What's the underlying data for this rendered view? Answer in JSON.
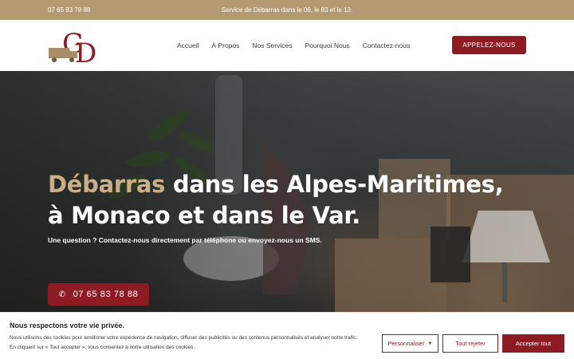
{
  "topbar": {
    "phone": "07 65 83 78 88",
    "service": "Service de Débarras dans le 06, le 83 et le 13."
  },
  "header": {
    "logo_text": "GD",
    "nav": [
      "Accueil",
      "À Propos",
      "Nos Services",
      "Pourquoi Nous",
      "Contactez-nous"
    ],
    "cta": "APPELEZ-NOUS"
  },
  "hero": {
    "title_accent": "Débarras",
    "title_rest_line1": " dans les Alpes-Maritimes,",
    "title_line2": "à Monaco et dans le Var.",
    "subtitle": "Une question ? Contactez-nous directement par téléphone ou envoyez-nous un SMS.",
    "cta_phone": "07 65 83 78 88",
    "cta_icon": "phone-icon"
  },
  "cookie": {
    "title": "Nous respectons votre vie privée.",
    "text1": "Nous utilisons des cookies pour améliorer votre expérience de navigation, diffuser des publicités ou des contenus personnalisés et analyser notre trafic.",
    "text2": "En cliquant sur « Tout accepter », vous consentez à notre utilisation des cookies.",
    "customize": "Personnaliser",
    "reject": "Tout rejeter",
    "accept": "Accepter tout"
  },
  "colors": {
    "gold": "#b39a72",
    "accent_title": "#c9ae86",
    "brand_red": "#8c1b24"
  }
}
